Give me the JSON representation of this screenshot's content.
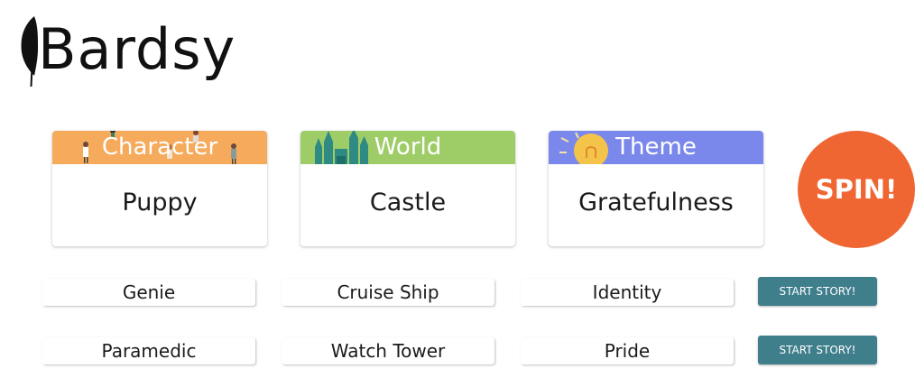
{
  "brand": {
    "name": "Bardsy",
    "logo_icon": "feather-icon"
  },
  "cards": [
    {
      "header": "Character",
      "value": "Puppy",
      "color": "#f6aa5c",
      "icon": "people-icon"
    },
    {
      "header": "World",
      "value": "Castle",
      "color": "#9ecd68",
      "icon": "castle-icon"
    },
    {
      "header": "Theme",
      "value": "Gratefulness",
      "color": "#7a88ec",
      "icon": "lightbulb-icon"
    }
  ],
  "spin": {
    "label": "SPIN!",
    "color": "#ef6633"
  },
  "suggestions": [
    {
      "character": "Genie",
      "world": "Cruise Ship",
      "theme": "Identity",
      "button": "START STORY!"
    },
    {
      "character": "Paramedic",
      "world": "Watch Tower",
      "theme": "Pride",
      "button": "START STORY!"
    }
  ],
  "colors": {
    "start_button": "#3f7f8c"
  }
}
